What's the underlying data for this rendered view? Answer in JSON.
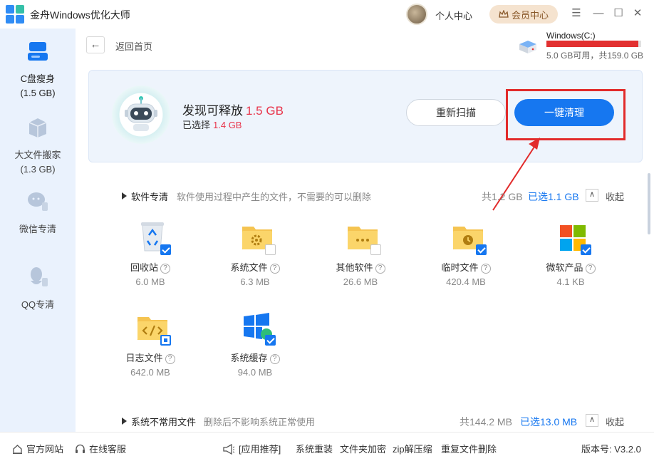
{
  "app": {
    "title": "金舟Windows优化大师",
    "user_center": "个人中心",
    "vip_label": "会员中心",
    "brand_colors": {
      "primary": "#1677f0",
      "danger": "#e8334a",
      "sidebar_bg": "#eaf2fd"
    }
  },
  "window_controls": [
    "menu-icon",
    "minimize-icon",
    "maximize-icon",
    "close-icon"
  ],
  "sidebar": {
    "items": [
      {
        "label": "C盘瘦身",
        "sub": "(1.5 GB)",
        "icon": "disk-icon",
        "active": true
      },
      {
        "label": "大文件搬家",
        "sub": "(1.3 GB)",
        "icon": "box-icon",
        "active": false
      },
      {
        "label": "微信专清",
        "sub": "",
        "icon": "wechat-broom-icon",
        "active": false
      },
      {
        "label": "QQ专清",
        "sub": "",
        "icon": "qq-broom-icon",
        "active": false
      }
    ]
  },
  "nav": {
    "back_label": "返回首页"
  },
  "disk": {
    "name": "Windows(C:)",
    "info": "5.0 GB可用，共159.0 GB",
    "used_fraction": 0.97
  },
  "scan": {
    "found_label": "发现可释放",
    "found_value": "1.5 GB",
    "selected_label": "已选择",
    "selected_value": "1.4 GB",
    "rescan_label": "重新扫描",
    "clean_label": "一键清理"
  },
  "sections": [
    {
      "title": "软件专清",
      "desc": "软件使用过程中产生的文件，不需要的可以删除",
      "total": "共1.2 GB",
      "selected": "已选1.1 GB",
      "collapse": "收起",
      "items": [
        {
          "name": "回收站",
          "size": "6.0 MB",
          "check": "on",
          "icon": "recycle-bin-icon"
        },
        {
          "name": "系统文件",
          "size": "6.3 MB",
          "check": "off",
          "icon": "folder-gear-icon"
        },
        {
          "name": "其他软件",
          "size": "26.6 MB",
          "check": "off",
          "icon": "folder-dots-icon"
        },
        {
          "name": "临时文件",
          "size": "420.4 MB",
          "check": "on",
          "icon": "folder-clock-icon"
        },
        {
          "name": "微软产品",
          "size": "4.1 KB",
          "check": "on",
          "icon": "microsoft-logo-icon"
        },
        {
          "name": "日志文件",
          "size": "642.0 MB",
          "check": "partial",
          "icon": "folder-code-icon"
        },
        {
          "name": "系统缓存",
          "size": "94.0 MB",
          "check": "on",
          "icon": "windows-cache-icon"
        }
      ]
    },
    {
      "title": "系统不常用文件",
      "desc": "删除后不影响系统正常使用",
      "total": "共144.2 MB",
      "selected": "已选13.0 MB",
      "collapse": "收起"
    }
  ],
  "footer": {
    "website": "官方网站",
    "service": "在线客服",
    "recommend": "[应用推荐]",
    "links": [
      "系统重装",
      "文件夹加密",
      "zip解压缩",
      "重复文件删除"
    ],
    "version": "版本号: V3.2.0"
  }
}
